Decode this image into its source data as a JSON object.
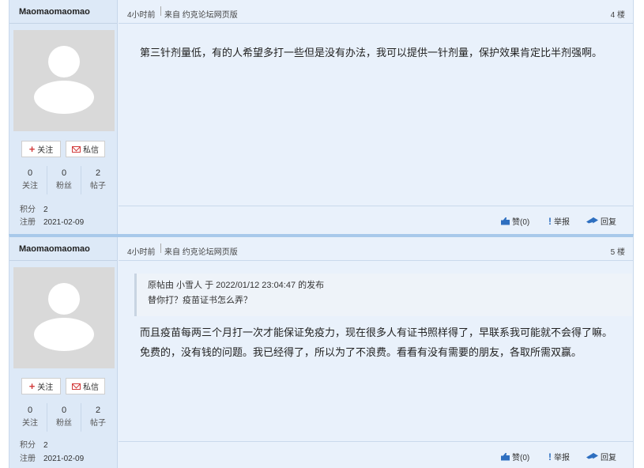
{
  "posts": [
    {
      "username": "Maomaomaomao",
      "time": "4小时前",
      "source": "来自 约克论坛网页版",
      "floor": "4 楼",
      "follow_label": "关注",
      "msg_label": "私信",
      "stats": [
        {
          "num": "0",
          "label": "关注"
        },
        {
          "num": "0",
          "label": "粉丝"
        },
        {
          "num": "2",
          "label": "帖子"
        }
      ],
      "points_label": "积分",
      "points": "2",
      "reg_label": "注册",
      "reg_date": "2021-02-09",
      "content_lines": [
        "第三针剂量低，有的人希望多打一些但是没有办法，我可以提供一针剂量，保护效果肯定比半剂强啊。"
      ],
      "like_label": "赞(0)",
      "report_label": "举报",
      "reply_label": "回复"
    },
    {
      "username": "Maomaomaomao",
      "time": "4小时前",
      "source": "来自 约克论坛网页版",
      "floor": "5 楼",
      "follow_label": "关注",
      "msg_label": "私信",
      "stats": [
        {
          "num": "0",
          "label": "关注"
        },
        {
          "num": "0",
          "label": "粉丝"
        },
        {
          "num": "2",
          "label": "帖子"
        }
      ],
      "points_label": "积分",
      "points": "2",
      "reg_label": "注册",
      "reg_date": "2021-02-09",
      "quote_header": "原帖由 小雪人 于 2022/01/12 23:04:47 的发布",
      "quote_text": "替你打？疫苗证书怎么弄？",
      "content_lines": [
        "而且疫苗每两三个月打一次才能保证免疫力，现在很多人有证书照样得了，早联系我可能就不会得了嘛。",
        "免费的，没有钱的问题。我已经得了，所以为了不浪费。看看有没有需要的朋友，各取所需双赢。"
      ],
      "like_label": "赞(0)",
      "report_label": "举报",
      "reply_label": "回复"
    }
  ]
}
